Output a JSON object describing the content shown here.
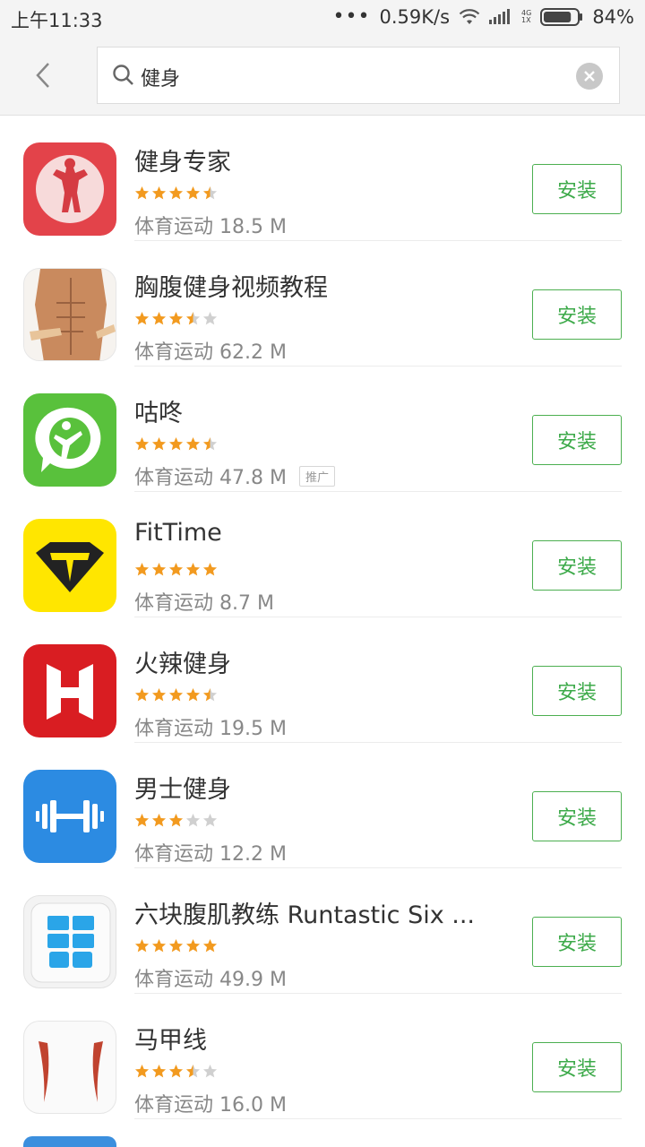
{
  "status_bar": {
    "time": "上午11:33",
    "dots": "•••",
    "speed": "0.59K/s",
    "net_4g": "4G",
    "net_1x": "1X",
    "battery": "84%",
    "battery_level": 0.84
  },
  "search": {
    "query": "健身"
  },
  "install_label": "安装",
  "apps": [
    {
      "name": "健身专家",
      "category_size": "体育运动 18.5 M",
      "rating": 4.5,
      "icon": "bodybuilder-icon",
      "promo": ""
    },
    {
      "name": "胸腹健身视频教程",
      "category_size": "体育运动 62.2 M",
      "rating": 3.5,
      "icon": "abs-photo-icon",
      "promo": ""
    },
    {
      "name": "咕咚",
      "category_size": "体育运动 47.8 M",
      "rating": 4.5,
      "icon": "codoon-icon",
      "promo": "推广"
    },
    {
      "name": "FitTime",
      "category_size": "体育运动 8.7 M",
      "rating": 5,
      "icon": "fittime-icon",
      "promo": ""
    },
    {
      "name": "火辣健身",
      "category_size": "体育运动 19.5 M",
      "rating": 4.5,
      "icon": "hotfit-icon",
      "promo": ""
    },
    {
      "name": "男士健身",
      "category_size": "体育运动 12.2 M",
      "rating": 3,
      "icon": "dumbbell-icon",
      "promo": ""
    },
    {
      "name": "六块腹肌教练 Runtastic Six ...",
      "category_size": "体育运动 49.9 M",
      "rating": 5,
      "icon": "sixpack-icon",
      "promo": ""
    },
    {
      "name": "马甲线",
      "category_size": "体育运动 16.0 M",
      "rating": 3.5,
      "icon": "vest-line-icon",
      "promo": ""
    }
  ],
  "colors": {
    "accent_green": "#3daa4a",
    "star_orange": "#f29a1f",
    "star_gray": "#d0d0d0"
  }
}
